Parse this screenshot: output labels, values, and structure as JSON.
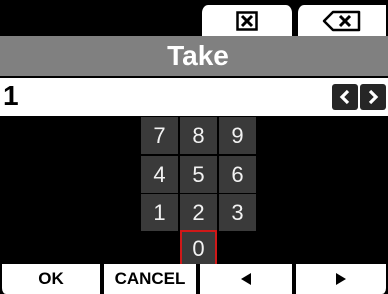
{
  "topbar": {
    "clear_icon": "close-box-icon",
    "backspace_icon": "backspace-icon"
  },
  "header": {
    "title": "Take"
  },
  "entry": {
    "value": "1",
    "cursor_left_icon": "chevron-left-icon",
    "cursor_right_icon": "chevron-right-icon"
  },
  "keypad": {
    "k7": "7",
    "k8": "8",
    "k9": "9",
    "k4": "4",
    "k5": "5",
    "k6": "6",
    "k1": "1",
    "k2": "2",
    "k3": "3",
    "k0": "0",
    "selected_key": "0",
    "selected_border_color": "#d01818"
  },
  "softkeys": {
    "ok": "OK",
    "cancel": "CANCEL",
    "left_icon": "triangle-left-icon",
    "right_icon": "triangle-right-icon"
  }
}
